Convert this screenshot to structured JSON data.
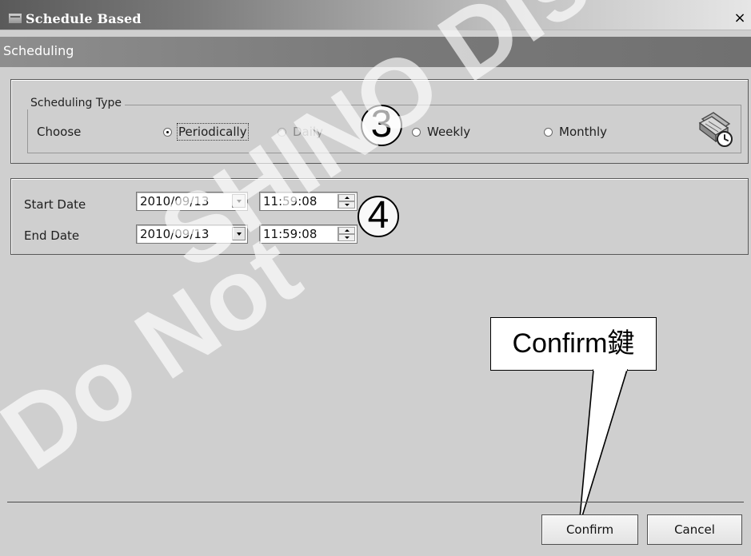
{
  "window": {
    "title": "Schedule Based",
    "close_label": "×"
  },
  "header": {
    "section_title": "Scheduling"
  },
  "scheduling_type": {
    "group_label": "Scheduling Type",
    "choose_label": "Choose",
    "options": [
      {
        "label": "Periodically",
        "selected": true,
        "enabled": true
      },
      {
        "label": "Daily",
        "selected": false,
        "enabled": false
      },
      {
        "label": "Weekly",
        "selected": false,
        "enabled": true
      },
      {
        "label": "Monthly",
        "selected": false,
        "enabled": true
      }
    ],
    "icon_name": "scheduler-clock-icon"
  },
  "schedule": {
    "start_label": "Start Date",
    "end_label": "End Date",
    "start_date": "2010/09/13",
    "start_time": "11:59:08",
    "end_date": "2010/09/13",
    "end_time": "11:59:08"
  },
  "actions": {
    "confirm_label": "Confirm",
    "cancel_label": "Cancel"
  },
  "annotations": {
    "step_3": "3",
    "step_4": "4",
    "callout_text": "Confirm鍵"
  },
  "watermark": {
    "line_1": "SHINO Distri",
    "line_2": "Do Not"
  },
  "colors": {
    "window_background": "#cfcfcf",
    "title_gradient_dark": "#5a5a5a",
    "title_gradient_light": "#e6e6e6",
    "section_bar": "#7a7a7a"
  }
}
